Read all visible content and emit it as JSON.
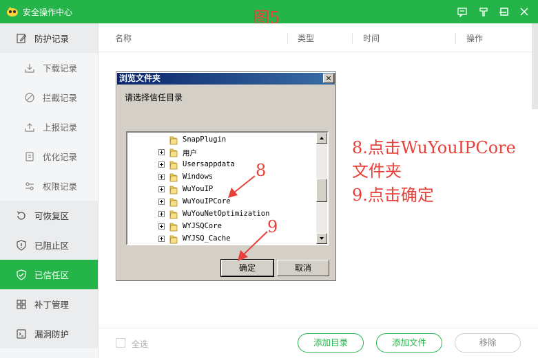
{
  "titlebar": {
    "title": "安全操作中心",
    "figure_label": "图5",
    "controls": [
      "feedback-icon",
      "skin-icon",
      "minimize-icon",
      "maximize-icon",
      "close-icon"
    ]
  },
  "sidebar": {
    "items": [
      {
        "label": "防护记录",
        "icon": "edit-icon",
        "level": "top"
      },
      {
        "label": "下载记录",
        "icon": "download-icon",
        "level": "sub"
      },
      {
        "label": "拦截记录",
        "icon": "block-icon",
        "level": "sub"
      },
      {
        "label": "上报记录",
        "icon": "upload-icon",
        "level": "sub"
      },
      {
        "label": "优化记录",
        "icon": "optimize-icon",
        "level": "sub"
      },
      {
        "label": "权限记录",
        "icon": "permission-icon",
        "level": "sub"
      },
      {
        "label": "可恢复区",
        "icon": "restore-icon",
        "level": "top"
      },
      {
        "label": "已阻止区",
        "icon": "shield-block-icon",
        "level": "top"
      },
      {
        "label": "已信任区",
        "icon": "shield-check-icon",
        "level": "top",
        "active": true
      },
      {
        "label": "补丁管理",
        "icon": "patch-icon",
        "level": "top"
      },
      {
        "label": "漏洞防护",
        "icon": "vulnerability-icon",
        "level": "top"
      }
    ]
  },
  "table": {
    "headers": [
      "名称",
      "类型",
      "时间",
      "操作"
    ]
  },
  "bottombar": {
    "select_all": "全选",
    "add_dir": "添加目录",
    "add_file": "添加文件",
    "remove": "移除"
  },
  "dialog": {
    "title": "浏览文件夹",
    "close": "×",
    "prompt": "请选择信任目录",
    "folders": [
      {
        "name": "SnapPlugin",
        "expandable": false
      },
      {
        "name": "用户",
        "expandable": true
      },
      {
        "name": "Usersappdata",
        "expandable": true
      },
      {
        "name": "Windows",
        "expandable": true
      },
      {
        "name": "WuYouIP",
        "expandable": true
      },
      {
        "name": "WuYouIPCore",
        "expandable": true
      },
      {
        "name": "WuYouNetOptimization",
        "expandable": true
      },
      {
        "name": "WYJSQCore",
        "expandable": true
      },
      {
        "name": "WYJSQ_Cache",
        "expandable": true
      }
    ],
    "ok": "确定",
    "cancel": "取消"
  },
  "annotations": {
    "num8": "8",
    "num9": "9",
    "line1": "8.点击WuYouIPCore",
    "line2": "文件夹",
    "line3": "9.点击确定",
    "color": "#e8413a"
  },
  "colors": {
    "brand_green": "#25b44a",
    "annotation_red": "#e8413a",
    "dialog_face": "#d4d0c8"
  }
}
